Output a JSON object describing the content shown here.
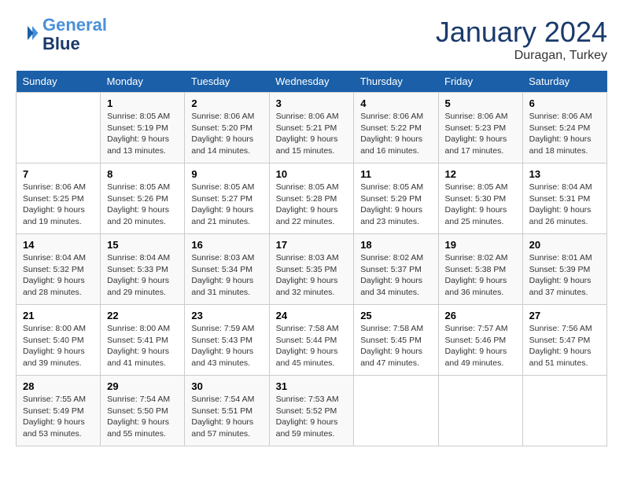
{
  "header": {
    "logo_line1": "General",
    "logo_line2": "Blue",
    "month": "January 2024",
    "location": "Duragan, Turkey"
  },
  "weekdays": [
    "Sunday",
    "Monday",
    "Tuesday",
    "Wednesday",
    "Thursday",
    "Friday",
    "Saturday"
  ],
  "weeks": [
    [
      {
        "day": "",
        "sunrise": "",
        "sunset": "",
        "daylight": ""
      },
      {
        "day": "1",
        "sunrise": "Sunrise: 8:05 AM",
        "sunset": "Sunset: 5:19 PM",
        "daylight": "Daylight: 9 hours and 13 minutes."
      },
      {
        "day": "2",
        "sunrise": "Sunrise: 8:06 AM",
        "sunset": "Sunset: 5:20 PM",
        "daylight": "Daylight: 9 hours and 14 minutes."
      },
      {
        "day": "3",
        "sunrise": "Sunrise: 8:06 AM",
        "sunset": "Sunset: 5:21 PM",
        "daylight": "Daylight: 9 hours and 15 minutes."
      },
      {
        "day": "4",
        "sunrise": "Sunrise: 8:06 AM",
        "sunset": "Sunset: 5:22 PM",
        "daylight": "Daylight: 9 hours and 16 minutes."
      },
      {
        "day": "5",
        "sunrise": "Sunrise: 8:06 AM",
        "sunset": "Sunset: 5:23 PM",
        "daylight": "Daylight: 9 hours and 17 minutes."
      },
      {
        "day": "6",
        "sunrise": "Sunrise: 8:06 AM",
        "sunset": "Sunset: 5:24 PM",
        "daylight": "Daylight: 9 hours and 18 minutes."
      }
    ],
    [
      {
        "day": "7",
        "sunrise": "Sunrise: 8:06 AM",
        "sunset": "Sunset: 5:25 PM",
        "daylight": "Daylight: 9 hours and 19 minutes."
      },
      {
        "day": "8",
        "sunrise": "Sunrise: 8:05 AM",
        "sunset": "Sunset: 5:26 PM",
        "daylight": "Daylight: 9 hours and 20 minutes."
      },
      {
        "day": "9",
        "sunrise": "Sunrise: 8:05 AM",
        "sunset": "Sunset: 5:27 PM",
        "daylight": "Daylight: 9 hours and 21 minutes."
      },
      {
        "day": "10",
        "sunrise": "Sunrise: 8:05 AM",
        "sunset": "Sunset: 5:28 PM",
        "daylight": "Daylight: 9 hours and 22 minutes."
      },
      {
        "day": "11",
        "sunrise": "Sunrise: 8:05 AM",
        "sunset": "Sunset: 5:29 PM",
        "daylight": "Daylight: 9 hours and 23 minutes."
      },
      {
        "day": "12",
        "sunrise": "Sunrise: 8:05 AM",
        "sunset": "Sunset: 5:30 PM",
        "daylight": "Daylight: 9 hours and 25 minutes."
      },
      {
        "day": "13",
        "sunrise": "Sunrise: 8:04 AM",
        "sunset": "Sunset: 5:31 PM",
        "daylight": "Daylight: 9 hours and 26 minutes."
      }
    ],
    [
      {
        "day": "14",
        "sunrise": "Sunrise: 8:04 AM",
        "sunset": "Sunset: 5:32 PM",
        "daylight": "Daylight: 9 hours and 28 minutes."
      },
      {
        "day": "15",
        "sunrise": "Sunrise: 8:04 AM",
        "sunset": "Sunset: 5:33 PM",
        "daylight": "Daylight: 9 hours and 29 minutes."
      },
      {
        "day": "16",
        "sunrise": "Sunrise: 8:03 AM",
        "sunset": "Sunset: 5:34 PM",
        "daylight": "Daylight: 9 hours and 31 minutes."
      },
      {
        "day": "17",
        "sunrise": "Sunrise: 8:03 AM",
        "sunset": "Sunset: 5:35 PM",
        "daylight": "Daylight: 9 hours and 32 minutes."
      },
      {
        "day": "18",
        "sunrise": "Sunrise: 8:02 AM",
        "sunset": "Sunset: 5:37 PM",
        "daylight": "Daylight: 9 hours and 34 minutes."
      },
      {
        "day": "19",
        "sunrise": "Sunrise: 8:02 AM",
        "sunset": "Sunset: 5:38 PM",
        "daylight": "Daylight: 9 hours and 36 minutes."
      },
      {
        "day": "20",
        "sunrise": "Sunrise: 8:01 AM",
        "sunset": "Sunset: 5:39 PM",
        "daylight": "Daylight: 9 hours and 37 minutes."
      }
    ],
    [
      {
        "day": "21",
        "sunrise": "Sunrise: 8:00 AM",
        "sunset": "Sunset: 5:40 PM",
        "daylight": "Daylight: 9 hours and 39 minutes."
      },
      {
        "day": "22",
        "sunrise": "Sunrise: 8:00 AM",
        "sunset": "Sunset: 5:41 PM",
        "daylight": "Daylight: 9 hours and 41 minutes."
      },
      {
        "day": "23",
        "sunrise": "Sunrise: 7:59 AM",
        "sunset": "Sunset: 5:43 PM",
        "daylight": "Daylight: 9 hours and 43 minutes."
      },
      {
        "day": "24",
        "sunrise": "Sunrise: 7:58 AM",
        "sunset": "Sunset: 5:44 PM",
        "daylight": "Daylight: 9 hours and 45 minutes."
      },
      {
        "day": "25",
        "sunrise": "Sunrise: 7:58 AM",
        "sunset": "Sunset: 5:45 PM",
        "daylight": "Daylight: 9 hours and 47 minutes."
      },
      {
        "day": "26",
        "sunrise": "Sunrise: 7:57 AM",
        "sunset": "Sunset: 5:46 PM",
        "daylight": "Daylight: 9 hours and 49 minutes."
      },
      {
        "day": "27",
        "sunrise": "Sunrise: 7:56 AM",
        "sunset": "Sunset: 5:47 PM",
        "daylight": "Daylight: 9 hours and 51 minutes."
      }
    ],
    [
      {
        "day": "28",
        "sunrise": "Sunrise: 7:55 AM",
        "sunset": "Sunset: 5:49 PM",
        "daylight": "Daylight: 9 hours and 53 minutes."
      },
      {
        "day": "29",
        "sunrise": "Sunrise: 7:54 AM",
        "sunset": "Sunset: 5:50 PM",
        "daylight": "Daylight: 9 hours and 55 minutes."
      },
      {
        "day": "30",
        "sunrise": "Sunrise: 7:54 AM",
        "sunset": "Sunset: 5:51 PM",
        "daylight": "Daylight: 9 hours and 57 minutes."
      },
      {
        "day": "31",
        "sunrise": "Sunrise: 7:53 AM",
        "sunset": "Sunset: 5:52 PM",
        "daylight": "Daylight: 9 hours and 59 minutes."
      },
      {
        "day": "",
        "sunrise": "",
        "sunset": "",
        "daylight": ""
      },
      {
        "day": "",
        "sunrise": "",
        "sunset": "",
        "daylight": ""
      },
      {
        "day": "",
        "sunrise": "",
        "sunset": "",
        "daylight": ""
      }
    ]
  ]
}
